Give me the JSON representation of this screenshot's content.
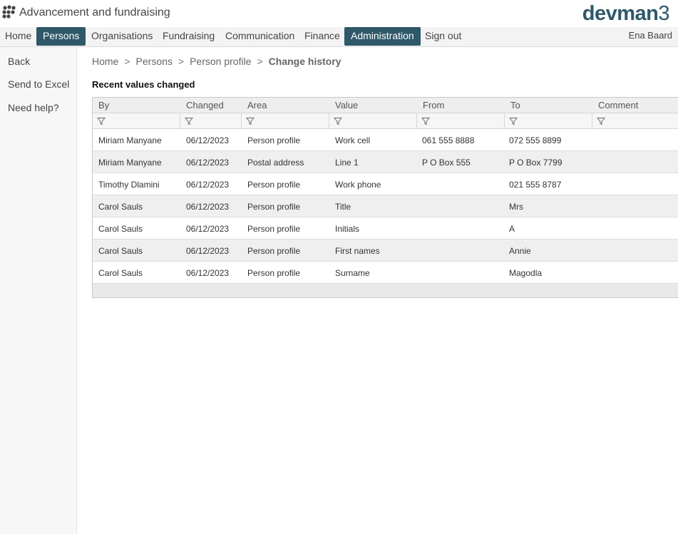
{
  "header": {
    "app_title": "Advancement and fundraising",
    "brand_name": "devman",
    "brand_suffix": "3",
    "logo_icon": "paw-dots-icon",
    "brand_color": "#2f5868"
  },
  "nav": {
    "items": [
      {
        "label": "Home",
        "active": false
      },
      {
        "label": "Persons",
        "active": true
      },
      {
        "label": "Organisations",
        "active": false
      },
      {
        "label": "Fundraising",
        "active": false
      },
      {
        "label": "Communication",
        "active": false
      },
      {
        "label": "Finance",
        "active": false
      },
      {
        "label": "Administration",
        "active": true
      },
      {
        "label": "Sign out",
        "active": false
      }
    ],
    "user_name": "Ena Baard"
  },
  "sidebar": {
    "items": [
      {
        "label": "Back"
      },
      {
        "label": "Send to Excel"
      },
      {
        "label": "Need help?"
      }
    ]
  },
  "breadcrumb": {
    "items": [
      "Home",
      "Persons",
      "Person profile"
    ],
    "separator": ">",
    "current": "Change history"
  },
  "section": {
    "title": "Recent values changed"
  },
  "grid": {
    "columns": [
      "By",
      "Changed",
      "Area",
      "Value",
      "From",
      "To",
      "Comment"
    ],
    "filter_icon": "filter-funnel-icon",
    "rows": [
      [
        "Miriam Manyane",
        "06/12/2023",
        "Person profile",
        "Work cell",
        "061 555 8888",
        "072 555 8899",
        ""
      ],
      [
        "Miriam Manyane",
        "06/12/2023",
        "Postal address",
        "Line 1",
        "P O Box 555",
        "P O Box 7799",
        ""
      ],
      [
        "Timothy Dlamini",
        "06/12/2023",
        "Person profile",
        "Work phone",
        "",
        "021 555 8787",
        ""
      ],
      [
        "Carol Sauls",
        "06/12/2023",
        "Person profile",
        "Title",
        "",
        "Mrs",
        ""
      ],
      [
        "Carol Sauls",
        "06/12/2023",
        "Person profile",
        "Initials",
        "",
        "A",
        ""
      ],
      [
        "Carol Sauls",
        "06/12/2023",
        "Person profile",
        "First names",
        "",
        "Annie",
        ""
      ],
      [
        "Carol Sauls",
        "06/12/2023",
        "Person profile",
        "Surname",
        "",
        "Magodla",
        ""
      ]
    ]
  }
}
